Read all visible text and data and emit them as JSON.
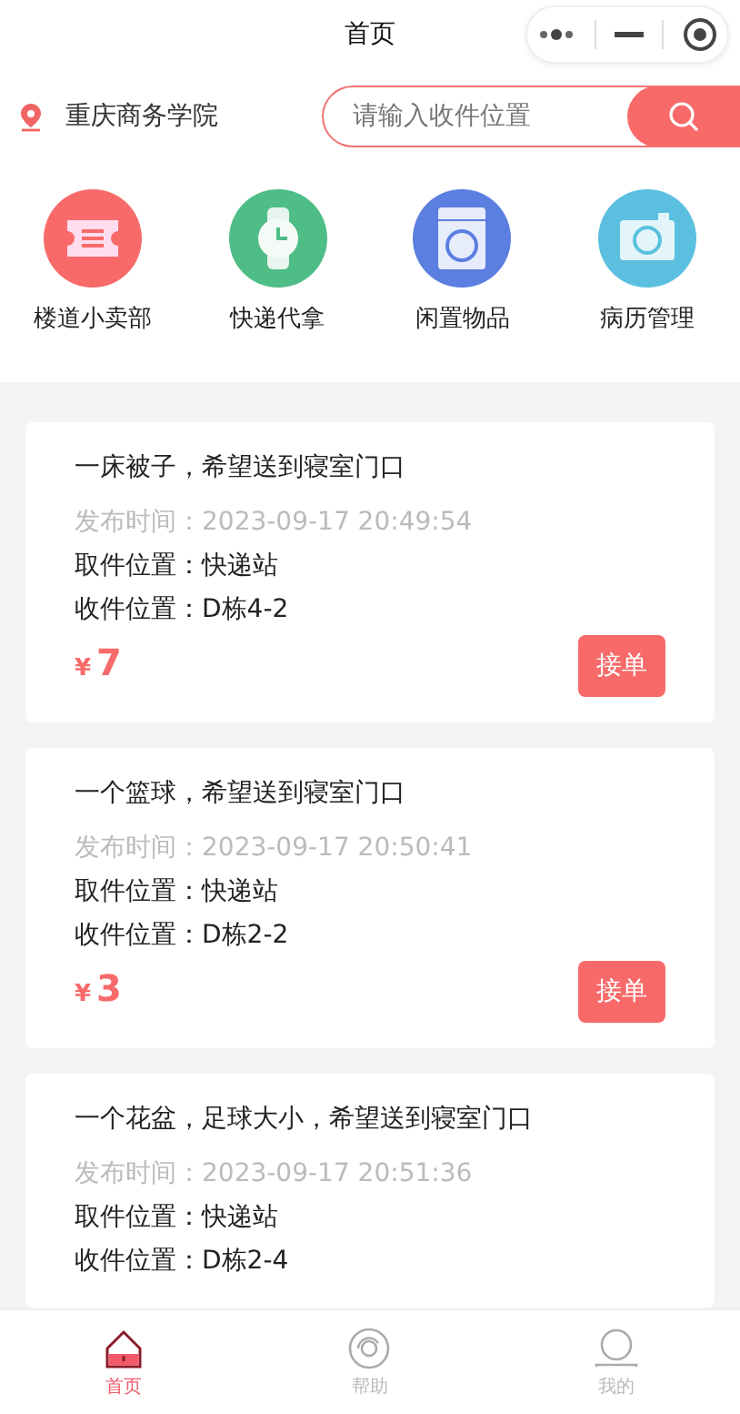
{
  "header": {
    "title": "首页"
  },
  "location": {
    "name": "重庆商务学院"
  },
  "search": {
    "placeholder": "请输入收件位置"
  },
  "categories": [
    {
      "label": "楼道小卖部",
      "kind": "ticket",
      "color": "#f86a6a"
    },
    {
      "label": "快递代拿",
      "kind": "watch",
      "color": "#4fbd86"
    },
    {
      "label": "闲置物品",
      "kind": "washer",
      "color": "#5b7fe0"
    },
    {
      "label": "病历管理",
      "kind": "camera",
      "color": "#5bc0e0"
    }
  ],
  "orders": [
    {
      "title": "一床被子，希望送到寝室门口",
      "time_label": "发布时间：",
      "time": "2023-09-17 20:49:54",
      "pickup": "取件位置：快递站",
      "dropoff": "收件位置：D栋4-2",
      "price_symbol": "¥",
      "price": "7",
      "action": "接单"
    },
    {
      "title": "一个篮球，希望送到寝室门口",
      "time_label": "发布时间：",
      "time": "2023-09-17 20:50:41",
      "pickup": "取件位置：快递站",
      "dropoff": "收件位置：D栋2-2",
      "price_symbol": "¥",
      "price": "3",
      "action": "接单"
    },
    {
      "title": "一个花盆，足球大小，希望送到寝室门口",
      "time_label": "发布时间：",
      "time": "2023-09-17 20:51:36",
      "pickup": "取件位置：快递站",
      "dropoff": "收件位置：D栋2-4"
    }
  ],
  "tab_bar": [
    {
      "label": "首页",
      "kind": "home",
      "selected": true
    },
    {
      "label": "帮助",
      "kind": "help",
      "selected": false
    },
    {
      "label": "我的",
      "kind": "user",
      "selected": false
    }
  ]
}
